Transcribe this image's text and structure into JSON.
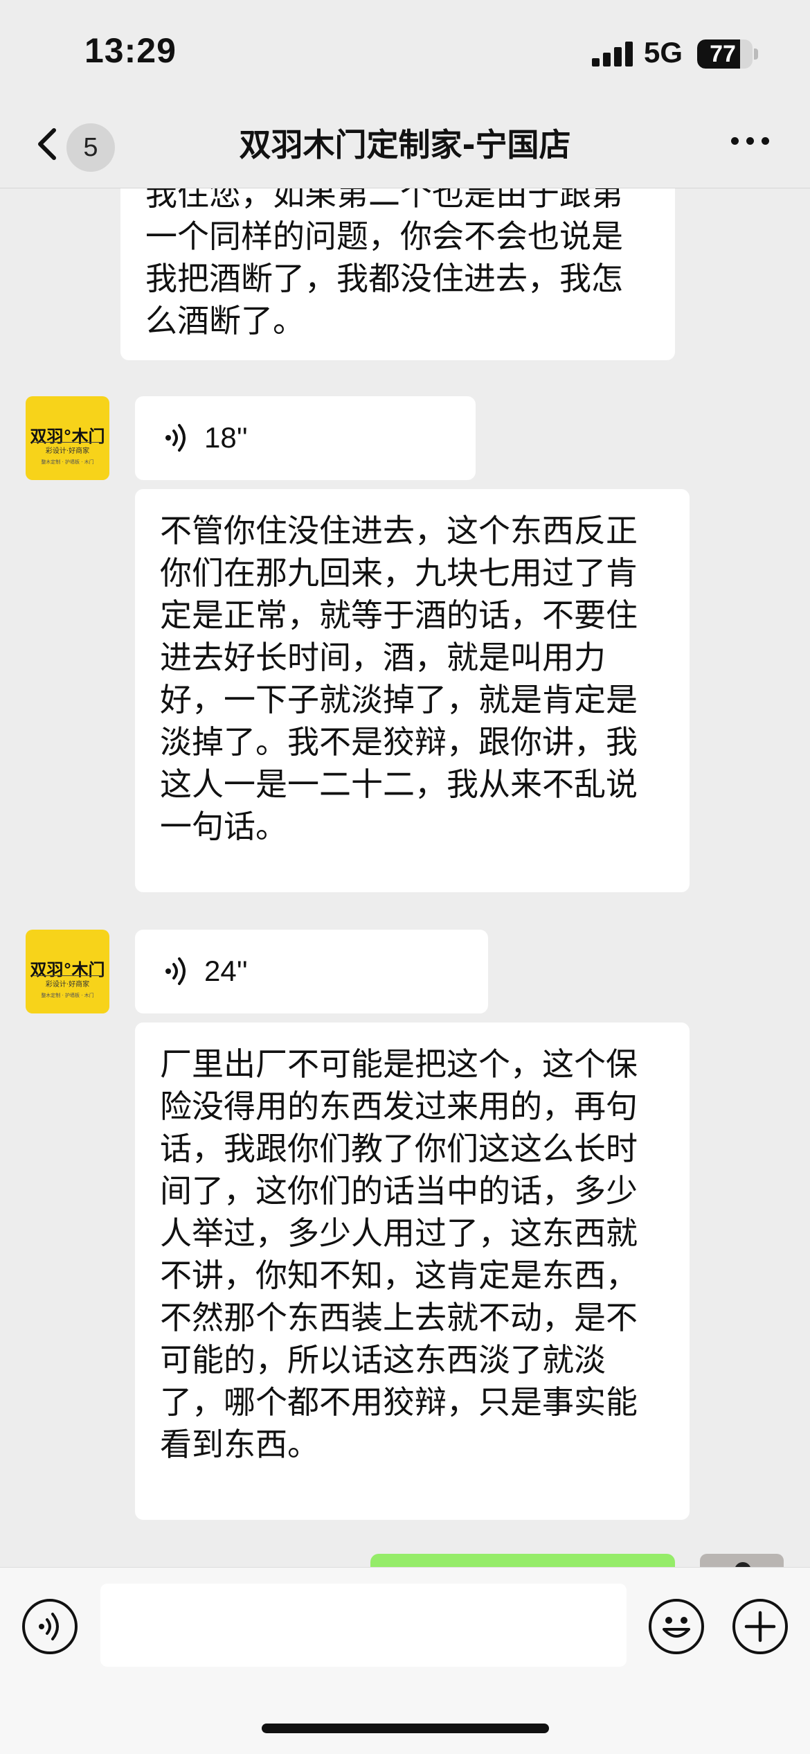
{
  "status_bar": {
    "time": "13:29",
    "network": "5G",
    "battery": "77",
    "battery_level": 0.77
  },
  "nav": {
    "back_icon": "chevron-left-icon",
    "unread_count": "5",
    "title": "双羽木门定制家-宁国店",
    "more_icon": "ellipsis-icon"
  },
  "messages": [
    {
      "type": "text",
      "sender": "other",
      "text": "我住您，如果第二个也是由于跟第一个同样的问题，你会不会也说是我把酒断了，我都没住进去，我怎么酒断了。"
    },
    {
      "type": "voice",
      "sender": "other",
      "duration": "18''",
      "transcript": "不管你住没住进去，这个东西反正你们在那九回来，九块七用过了肯定是正常，就等于酒的话，不要住进去好长时间，酒，就是叫用力好，一下子就淡掉了，就是肯定是淡掉了。我不是狡辩，跟你讲，我这人一是一二十二，我从来不乱说一句话。"
    },
    {
      "type": "voice",
      "sender": "other",
      "duration": "24''",
      "transcript": "厂里出厂不可能是把这个，这个保险没得用的东西发过来用的，再句话，我跟你们教了你们这这么长时间了，这你们的话当中的话，多少人举过，多少人用过了，这东西就不讲，你知不知，这肯定是东西，不然那个东西装上去就不动，是不可能的，所以话这东西淡了就淡了，哪个都不用狡辩，只是事实能看到东西。"
    }
  ],
  "avatar": {
    "brand": "双羽°木门",
    "tagline": "彩设计·好商家",
    "footer": "整木定制 · 护墙板 · 木门"
  },
  "input_bar": {
    "voice_toggle_icon": "voice-icon",
    "emoji_icon": "emoji-icon",
    "add_icon": "plus-icon",
    "input_value": ""
  }
}
